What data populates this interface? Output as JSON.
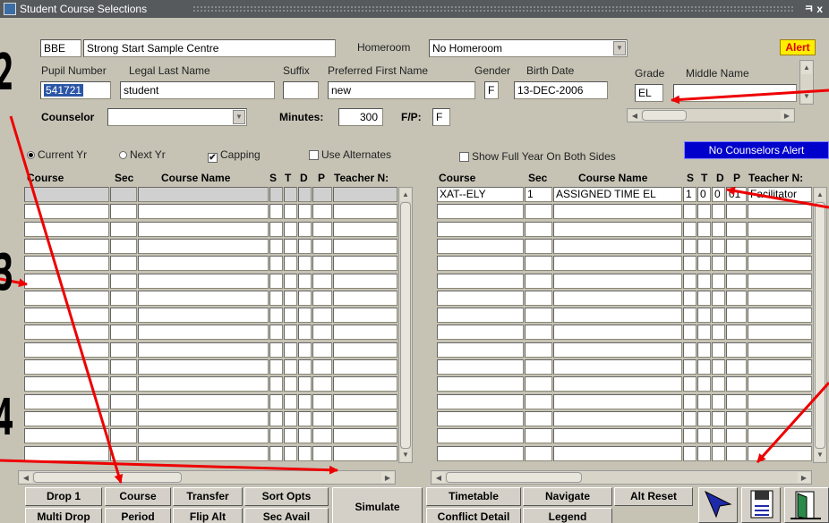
{
  "window": {
    "title": "Student Course Selections",
    "controls": "ㅋ x"
  },
  "header": {
    "school_code": "BBE",
    "school_name": "Strong Start Sample Centre",
    "homeroom_label": "Homeroom",
    "homeroom_value": "No Homeroom",
    "alert_label": "Alert",
    "pupil_number_label": "Pupil Number",
    "pupil_number": "541721",
    "legal_last_name_label": "Legal Last Name",
    "legal_last_name": "student",
    "suffix_label": "Suffix",
    "suffix": "",
    "preferred_first_name_label": "Preferred First Name",
    "preferred_first_name": "new",
    "gender_label": "Gender",
    "gender": "F",
    "birth_date_label": "Birth Date",
    "birth_date": "13-DEC-2006",
    "grade_label": "Grade",
    "grade": "EL",
    "middle_name_label": "Middle Name",
    "middle_name": "",
    "counselor_label": "Counselor",
    "counselor": "",
    "minutes_label": "Minutes:",
    "minutes": "300",
    "fp_label": "F/P:",
    "fp": "F"
  },
  "options": {
    "current_yr": "Current Yr",
    "next_yr": "Next Yr",
    "capping": "Capping",
    "use_alternates": "Use Alternates",
    "show_full_year": "Show Full Year On Both Sides",
    "no_counselors_alert": "No Counselors Alert"
  },
  "left_grid": {
    "columns": [
      "Course",
      "Sec",
      "Course Name",
      "S",
      "T",
      "D",
      "P",
      "Teacher N:"
    ],
    "rows": [
      [
        "",
        "",
        "",
        "",
        "",
        "",
        "",
        ""
      ]
    ]
  },
  "right_grid": {
    "columns": [
      "Course",
      "Sec",
      "Course Name",
      "S",
      "T",
      "D",
      "P",
      "Teacher N:"
    ],
    "rows": [
      [
        "XAT--ELY",
        "1",
        "ASSIGNED TIME EL",
        "1",
        "0",
        "0",
        "01",
        "Facilitator"
      ]
    ]
  },
  "buttons": {
    "drop1": "Drop 1",
    "course": "Course",
    "transfer": "Transfer",
    "sort_opts": "Sort Opts",
    "multi_drop": "Multi Drop",
    "period": "Period",
    "flip_alt": "Flip Alt",
    "sec_avail": "Sec Avail",
    "simulate": "Simulate",
    "timetable": "Timetable",
    "navigate": "Navigate",
    "alt_reset": "Alt Reset",
    "conflict_detail": "Conflict Detail",
    "legend": "Legend"
  },
  "annotations": {
    "n2": "2",
    "n3": "3",
    "n4": "4"
  },
  "colors": {
    "annotation_arrow": "#ee0000",
    "selection": "#2b56a6",
    "alert_bg": "#ffee00",
    "nc_alert_bg": "#0000cc"
  }
}
